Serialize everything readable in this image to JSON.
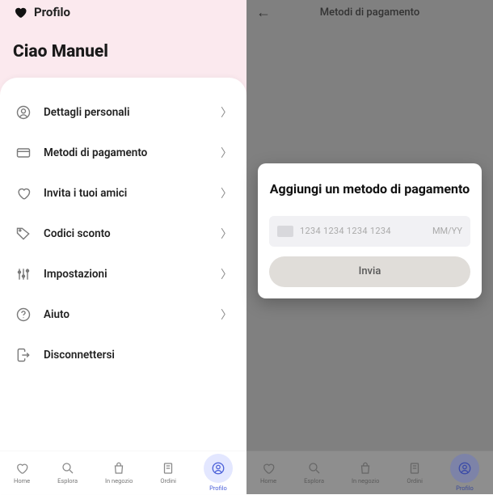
{
  "left": {
    "top_title": "Profilo",
    "greeting": "Ciao Manuel",
    "menu": [
      {
        "name": "personal-details",
        "label": "Dettagli personali",
        "icon": "user-circle-icon",
        "chevron": true
      },
      {
        "name": "payment-methods",
        "label": "Metodi di pagamento",
        "icon": "card-icon",
        "chevron": true
      },
      {
        "name": "invite-friends",
        "label": "Invita i tuoi amici",
        "icon": "heart-outline-icon",
        "chevron": true
      },
      {
        "name": "discount-codes",
        "label": "Codici sconto",
        "icon": "tag-icon",
        "chevron": true
      },
      {
        "name": "settings",
        "label": "Impostazioni",
        "icon": "sliders-icon",
        "chevron": true
      },
      {
        "name": "help",
        "label": "Aiuto",
        "icon": "help-circle-icon",
        "chevron": true
      },
      {
        "name": "logout",
        "label": "Disconnettersi",
        "icon": "logout-icon",
        "chevron": false
      }
    ]
  },
  "right": {
    "top_title": "Metodi di pagamento",
    "modal": {
      "title": "Aggiungi un metodo di pagamento",
      "card_number_placeholder": "1234 1234 1234 1234",
      "expiry_placeholder": "MM/YY",
      "submit_label": "Invia"
    }
  },
  "nav": {
    "items": [
      {
        "name": "home",
        "label": "Home",
        "icon": "heart-outline-icon"
      },
      {
        "name": "explore",
        "label": "Esplora",
        "icon": "search-icon"
      },
      {
        "name": "in-store",
        "label": "In negozio",
        "icon": "bag-icon"
      },
      {
        "name": "orders",
        "label": "Ordini",
        "icon": "receipt-icon"
      },
      {
        "name": "profile",
        "label": "Profilo",
        "icon": "user-circle-icon",
        "active": true
      }
    ]
  }
}
